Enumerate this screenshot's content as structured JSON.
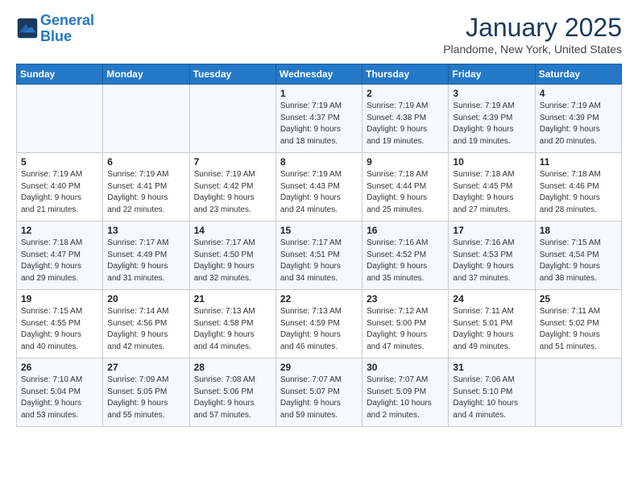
{
  "header": {
    "logo_line1": "General",
    "logo_line2": "Blue",
    "month": "January 2025",
    "location": "Plandome, New York, United States"
  },
  "weekdays": [
    "Sunday",
    "Monday",
    "Tuesday",
    "Wednesday",
    "Thursday",
    "Friday",
    "Saturday"
  ],
  "weeks": [
    [
      {
        "day": "",
        "info": ""
      },
      {
        "day": "",
        "info": ""
      },
      {
        "day": "",
        "info": ""
      },
      {
        "day": "1",
        "info": "Sunrise: 7:19 AM\nSunset: 4:37 PM\nDaylight: 9 hours\nand 18 minutes."
      },
      {
        "day": "2",
        "info": "Sunrise: 7:19 AM\nSunset: 4:38 PM\nDaylight: 9 hours\nand 19 minutes."
      },
      {
        "day": "3",
        "info": "Sunrise: 7:19 AM\nSunset: 4:39 PM\nDaylight: 9 hours\nand 19 minutes."
      },
      {
        "day": "4",
        "info": "Sunrise: 7:19 AM\nSunset: 4:39 PM\nDaylight: 9 hours\nand 20 minutes."
      }
    ],
    [
      {
        "day": "5",
        "info": "Sunrise: 7:19 AM\nSunset: 4:40 PM\nDaylight: 9 hours\nand 21 minutes."
      },
      {
        "day": "6",
        "info": "Sunrise: 7:19 AM\nSunset: 4:41 PM\nDaylight: 9 hours\nand 22 minutes."
      },
      {
        "day": "7",
        "info": "Sunrise: 7:19 AM\nSunset: 4:42 PM\nDaylight: 9 hours\nand 23 minutes."
      },
      {
        "day": "8",
        "info": "Sunrise: 7:19 AM\nSunset: 4:43 PM\nDaylight: 9 hours\nand 24 minutes."
      },
      {
        "day": "9",
        "info": "Sunrise: 7:18 AM\nSunset: 4:44 PM\nDaylight: 9 hours\nand 25 minutes."
      },
      {
        "day": "10",
        "info": "Sunrise: 7:18 AM\nSunset: 4:45 PM\nDaylight: 9 hours\nand 27 minutes."
      },
      {
        "day": "11",
        "info": "Sunrise: 7:18 AM\nSunset: 4:46 PM\nDaylight: 9 hours\nand 28 minutes."
      }
    ],
    [
      {
        "day": "12",
        "info": "Sunrise: 7:18 AM\nSunset: 4:47 PM\nDaylight: 9 hours\nand 29 minutes."
      },
      {
        "day": "13",
        "info": "Sunrise: 7:17 AM\nSunset: 4:49 PM\nDaylight: 9 hours\nand 31 minutes."
      },
      {
        "day": "14",
        "info": "Sunrise: 7:17 AM\nSunset: 4:50 PM\nDaylight: 9 hours\nand 32 minutes."
      },
      {
        "day": "15",
        "info": "Sunrise: 7:17 AM\nSunset: 4:51 PM\nDaylight: 9 hours\nand 34 minutes."
      },
      {
        "day": "16",
        "info": "Sunrise: 7:16 AM\nSunset: 4:52 PM\nDaylight: 9 hours\nand 35 minutes."
      },
      {
        "day": "17",
        "info": "Sunrise: 7:16 AM\nSunset: 4:53 PM\nDaylight: 9 hours\nand 37 minutes."
      },
      {
        "day": "18",
        "info": "Sunrise: 7:15 AM\nSunset: 4:54 PM\nDaylight: 9 hours\nand 38 minutes."
      }
    ],
    [
      {
        "day": "19",
        "info": "Sunrise: 7:15 AM\nSunset: 4:55 PM\nDaylight: 9 hours\nand 40 minutes."
      },
      {
        "day": "20",
        "info": "Sunrise: 7:14 AM\nSunset: 4:56 PM\nDaylight: 9 hours\nand 42 minutes."
      },
      {
        "day": "21",
        "info": "Sunrise: 7:13 AM\nSunset: 4:58 PM\nDaylight: 9 hours\nand 44 minutes."
      },
      {
        "day": "22",
        "info": "Sunrise: 7:13 AM\nSunset: 4:59 PM\nDaylight: 9 hours\nand 46 minutes."
      },
      {
        "day": "23",
        "info": "Sunrise: 7:12 AM\nSunset: 5:00 PM\nDaylight: 9 hours\nand 47 minutes."
      },
      {
        "day": "24",
        "info": "Sunrise: 7:11 AM\nSunset: 5:01 PM\nDaylight: 9 hours\nand 49 minutes."
      },
      {
        "day": "25",
        "info": "Sunrise: 7:11 AM\nSunset: 5:02 PM\nDaylight: 9 hours\nand 51 minutes."
      }
    ],
    [
      {
        "day": "26",
        "info": "Sunrise: 7:10 AM\nSunset: 5:04 PM\nDaylight: 9 hours\nand 53 minutes."
      },
      {
        "day": "27",
        "info": "Sunrise: 7:09 AM\nSunset: 5:05 PM\nDaylight: 9 hours\nand 55 minutes."
      },
      {
        "day": "28",
        "info": "Sunrise: 7:08 AM\nSunset: 5:06 PM\nDaylight: 9 hours\nand 57 minutes."
      },
      {
        "day": "29",
        "info": "Sunrise: 7:07 AM\nSunset: 5:07 PM\nDaylight: 9 hours\nand 59 minutes."
      },
      {
        "day": "30",
        "info": "Sunrise: 7:07 AM\nSunset: 5:09 PM\nDaylight: 10 hours\nand 2 minutes."
      },
      {
        "day": "31",
        "info": "Sunrise: 7:06 AM\nSunset: 5:10 PM\nDaylight: 10 hours\nand 4 minutes."
      },
      {
        "day": "",
        "info": ""
      }
    ]
  ]
}
